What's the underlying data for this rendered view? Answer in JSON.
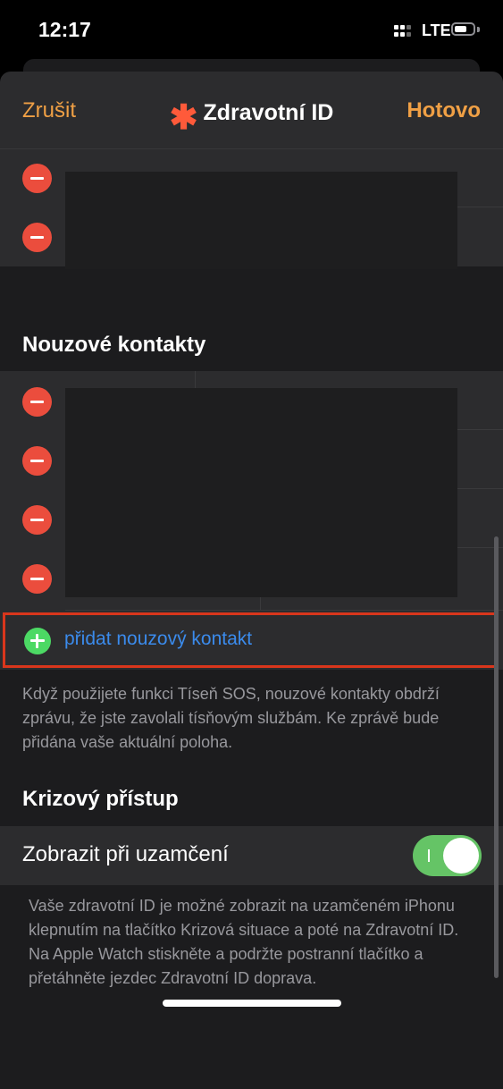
{
  "status_bar": {
    "time": "12:17",
    "network": "LTE"
  },
  "nav": {
    "cancel_label": "Zrušit",
    "title": "Zdravotní ID",
    "title_icon": "✱",
    "done_label": "Hotovo"
  },
  "emergency_contacts": {
    "header": "Nouzové kontakty",
    "add_label": "přidat nouzový kontakt",
    "footnote": "Když použijete funkci Tíseň SOS, nouzové kontakty obdrží zprávu, že jste zavolali tísňovým službám. Ke zprávě bude přidána vaše aktuální poloha."
  },
  "emergency_access": {
    "header": "Krizový přístup",
    "toggle_label": "Zobrazit při uzamčení",
    "toggle_on": true,
    "footnote": "Vaše zdravotní ID je možné zobrazit na uzamčeném iPhonu klepnutím na tlačítko Krizová situace a poté na Zdravotní ID. Na Apple Watch stiskněte a podržte postranní tlačítko a přetáhněte jezdec Zdravotní ID doprava."
  },
  "colors": {
    "accent": "#f0a045",
    "link": "#3b8bec",
    "delete": "#eb4d3d",
    "add": "#4cd964",
    "switch_on": "#65c466",
    "highlight": "#d9361c"
  },
  "icons": [
    "signal-icon",
    "battery-icon",
    "medical-star-icon",
    "remove-icon",
    "add-icon"
  ]
}
